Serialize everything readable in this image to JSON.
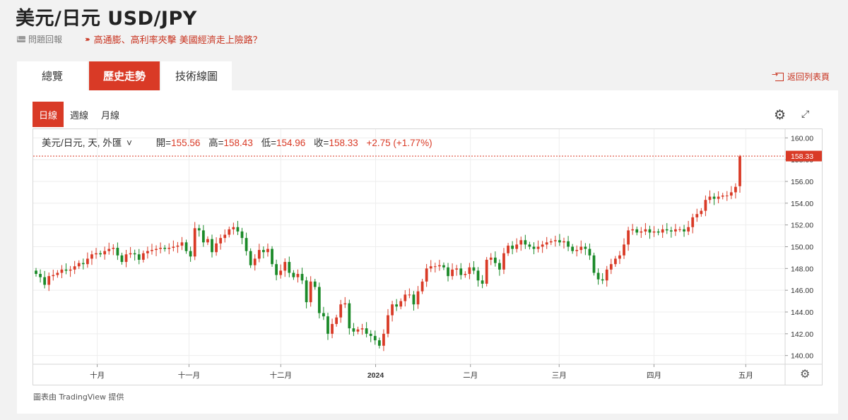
{
  "title": "美元/日元 USD/JPY",
  "report": {
    "label": "問題回報"
  },
  "headline": "高通膨、高利率夾擊 美國經濟走上險路？",
  "tabs": [
    "總覽",
    "歷史走勢",
    "技術線圖"
  ],
  "active_tab": "歷史走勢",
  "back_link": "返回列表頁",
  "intervals": [
    "日線",
    "週線",
    "月線"
  ],
  "active_interval": "日線",
  "legend": {
    "symbol": "美元/日元, 天, 外匯",
    "open_label": "開=",
    "open": "155.56",
    "high_label": "高=",
    "high": "158.43",
    "low_label": "低=",
    "low": "154.96",
    "close_label": "收=",
    "close": "158.33",
    "change": "+2.75 (+1.77%)"
  },
  "price_tag": "158.33",
  "credit": {
    "prefix": "圖表由",
    "source": "TradingView",
    "suffix": "提供"
  },
  "colors": {
    "up": "#d93a26",
    "down": "#1b8a29",
    "accent": "#d93a26"
  },
  "chart_data": {
    "type": "candlestick",
    "ylim": [
      139.2,
      160.8
    ],
    "y_ticks": [
      "160.00",
      "158.00",
      "156.00",
      "154.00",
      "152.00",
      "150.00",
      "148.00",
      "146.00",
      "144.00",
      "142.00",
      "140.00"
    ],
    "x_labels": [
      {
        "label": "十月",
        "date": "2023-10-02"
      },
      {
        "label": "十一月",
        "date": "2023-11-01"
      },
      {
        "label": "十二月",
        "date": "2023-12-01"
      },
      {
        "label": "2024",
        "date": "2024-01-01"
      },
      {
        "label": "二月",
        "date": "2024-02-01"
      },
      {
        "label": "三月",
        "date": "2024-03-01"
      },
      {
        "label": "四月",
        "date": "2024-04-01"
      },
      {
        "label": "五月",
        "date": "2024-05-01"
      }
    ],
    "close_series": [
      147.5,
      147.2,
      146.5,
      147.3,
      147.4,
      147.6,
      147.9,
      147.8,
      147.9,
      148.2,
      148.5,
      148.4,
      148.9,
      149.3,
      149.4,
      149.3,
      149.6,
      149.8,
      149.9,
      149.2,
      148.6,
      149.3,
      149.4,
      149.3,
      148.8,
      149.4,
      149.6,
      149.7,
      149.8,
      149.9,
      149.8,
      149.9,
      150.0,
      150.1,
      150.4,
      149.6,
      149.1,
      151.7,
      151.5,
      150.4,
      150.7,
      149.5,
      150.3,
      150.8,
      151.1,
      151.6,
      151.8,
      151.4,
      150.8,
      149.6,
      148.3,
      148.9,
      149.7,
      149.5,
      149.8,
      148.4,
      147.4,
      147.8,
      148.6,
      147.6,
      147.2,
      147.5,
      146.9,
      144.9,
      146.8,
      146.3,
      143.9,
      143.6,
      142.0,
      142.9,
      143.5,
      144.7,
      144.8,
      142.5,
      142.2,
      142.4,
      142.5,
      142.0,
      141.8,
      141.4,
      140.9,
      142.0,
      143.7,
      144.7,
      144.5,
      145.0,
      145.6,
      145.6,
      144.7,
      145.9,
      146.8,
      148.0,
      148.2,
      148.2,
      148.3,
      148.1,
      147.3,
      147.9,
      148.0,
      147.4,
      147.5,
      148.1,
      147.8,
      146.9,
      146.6,
      148.8,
      149.0,
      148.5,
      147.9,
      149.4,
      150.1,
      149.8,
      150.2,
      150.6,
      150.2,
      150.0,
      149.8,
      150.0,
      150.2,
      150.4,
      150.5,
      150.6,
      150.4,
      150.5,
      150.0,
      149.6,
      149.7,
      150.0,
      149.8,
      149.2,
      147.6,
      147.0,
      146.9,
      147.9,
      148.4,
      148.9,
      149.2,
      150.2,
      151.5,
      151.6,
      151.3,
      151.4,
      151.6,
      151.3,
      151.4,
      151.3,
      151.6,
      151.5,
      151.4,
      151.6,
      151.6,
      151.4,
      151.8,
      152.7,
      153.0,
      153.3,
      154.3,
      154.6,
      154.4,
      154.6,
      154.7,
      154.7,
      155.0,
      155.5,
      158.3
    ]
  }
}
